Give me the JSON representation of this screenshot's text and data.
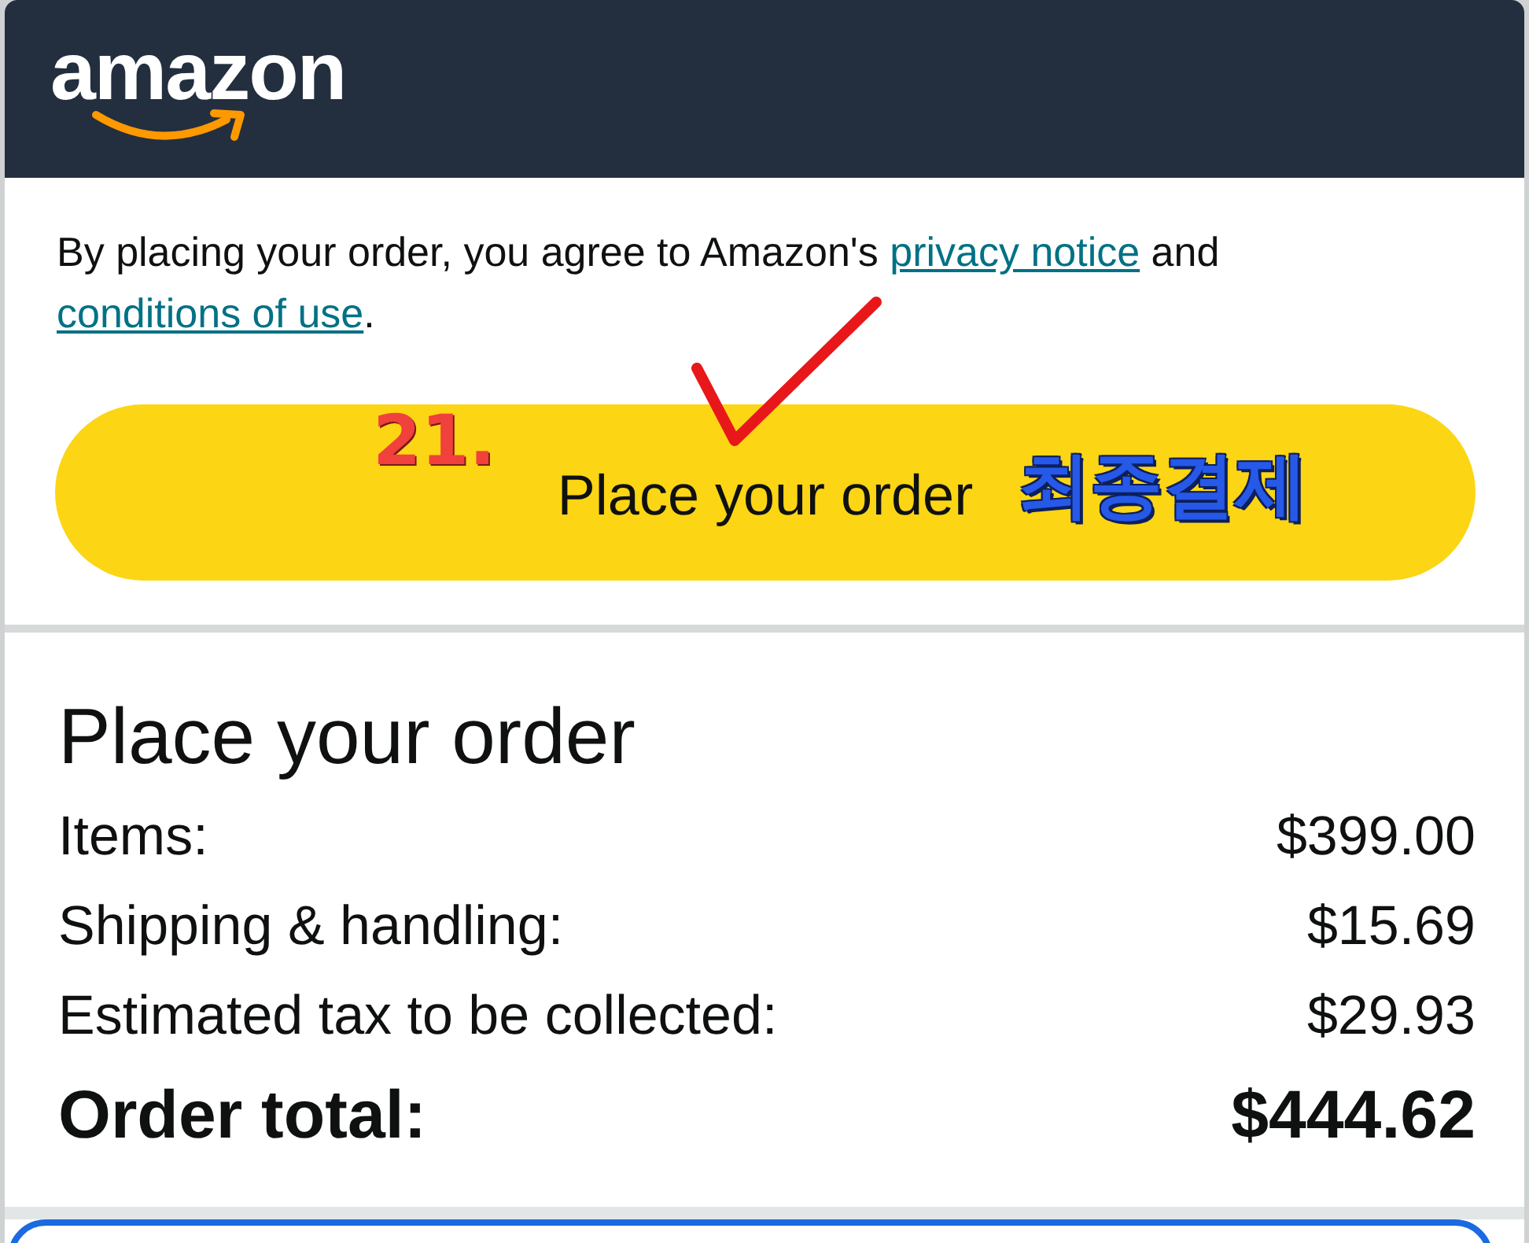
{
  "header": {
    "logo": "amazon"
  },
  "agreement": {
    "parts": [
      {
        "kind": "text",
        "text": "By placing your order, you agree to Amazon's "
      },
      {
        "kind": "link",
        "text": "privacy notice"
      },
      {
        "kind": "text",
        "text": " and "
      },
      {
        "kind": "link",
        "text": "conditions of use"
      },
      {
        "kind": "text",
        "text": "."
      }
    ]
  },
  "order_button": {
    "label": "Place your order"
  },
  "annotations": [
    {
      "kind": "step",
      "text": "21."
    },
    {
      "kind": "check"
    },
    {
      "kind": "caption",
      "text": "최종결제"
    }
  ],
  "summary": {
    "title": "Place your order",
    "rows": [
      {
        "label": "Items:",
        "value": "$399.00"
      },
      {
        "label": "Shipping & handling:",
        "value": "$15.69"
      },
      {
        "label": "Estimated tax to be collected:",
        "value": "$29.93"
      }
    ],
    "total": {
      "label": "Order total:",
      "value": "$444.62"
    }
  }
}
